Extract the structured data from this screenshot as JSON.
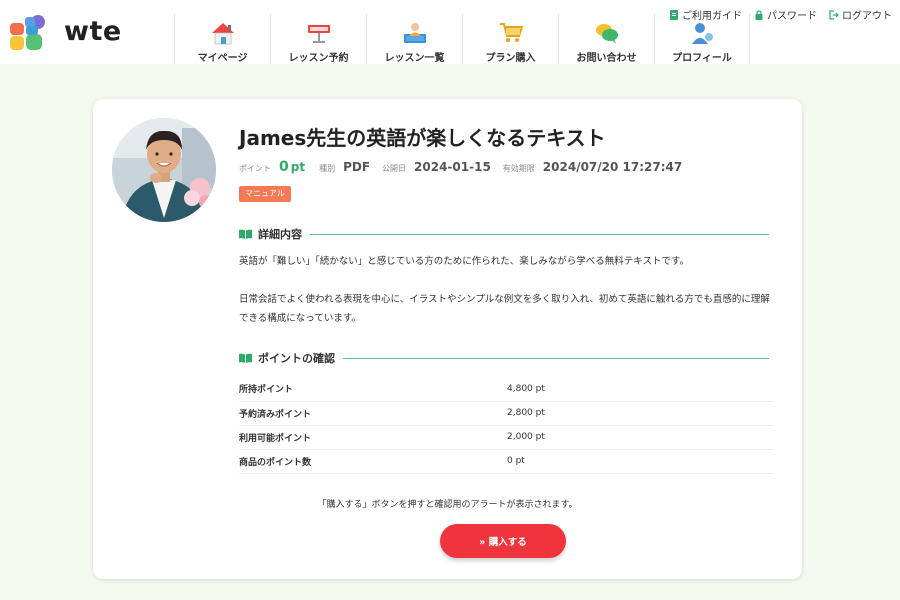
{
  "header": {
    "logo_text": "wte",
    "nav": [
      {
        "label": "マイページ",
        "icon": "house-icon"
      },
      {
        "label": "レッスン予約",
        "icon": "reserved-sign-icon"
      },
      {
        "label": "レッスン一覧",
        "icon": "teacher-monitor-icon"
      },
      {
        "label": "プラン購入",
        "icon": "cart-icon"
      },
      {
        "label": "お問い合わせ",
        "icon": "chat-bubbles-icon"
      },
      {
        "label": "プロフィール",
        "icon": "user-profile-icon"
      }
    ],
    "util_links": [
      {
        "label": "ご利用ガイド",
        "icon": "guide-icon"
      },
      {
        "label": "パスワード",
        "icon": "lock-icon"
      },
      {
        "label": "ログアウト",
        "icon": "logout-icon"
      }
    ]
  },
  "product": {
    "title": "James先生の英語が楽しくなるテキスト",
    "meta": {
      "points_label": "ポイント",
      "points_value": "0",
      "points_unit": "pt",
      "type_label": "種別",
      "type_value": "PDF",
      "published_label": "公開日",
      "published_value": "2024-01-15",
      "expiry_label": "有効期限",
      "expiry_value": "2024/07/20 17:27:47"
    },
    "tag": "マニュアル"
  },
  "details": {
    "heading": "詳細内容",
    "paragraph1": "英語が「難しい」「続かない」と感じている方のために作られた、楽しみながら学べる無料テキストです。",
    "paragraph2": "日常会話でよく使われる表現を中心に、イラストやシンプルな例文を多く取り入れ、初めて英語に触れる方でも直感的に理解できる構成になっています。"
  },
  "points": {
    "heading": "ポイントの確認",
    "rows": [
      {
        "label": "所持ポイント",
        "value": "4,800 pt"
      },
      {
        "label": "予約済みポイント",
        "value": "2,800 pt"
      },
      {
        "label": "利用可能ポイント",
        "value": "2,000 pt"
      },
      {
        "label": "商品のポイント数",
        "value": "0 pt"
      }
    ]
  },
  "purchase": {
    "note": "「購入する」ボタンを押すと確認用のアラートが表示されます。",
    "button_label": "» 購入する"
  },
  "colors": {
    "background": "#f2f9ee",
    "accent_green": "#2eaa6a",
    "tag_orange": "#f47a55",
    "buy_red": "#f0343c"
  }
}
